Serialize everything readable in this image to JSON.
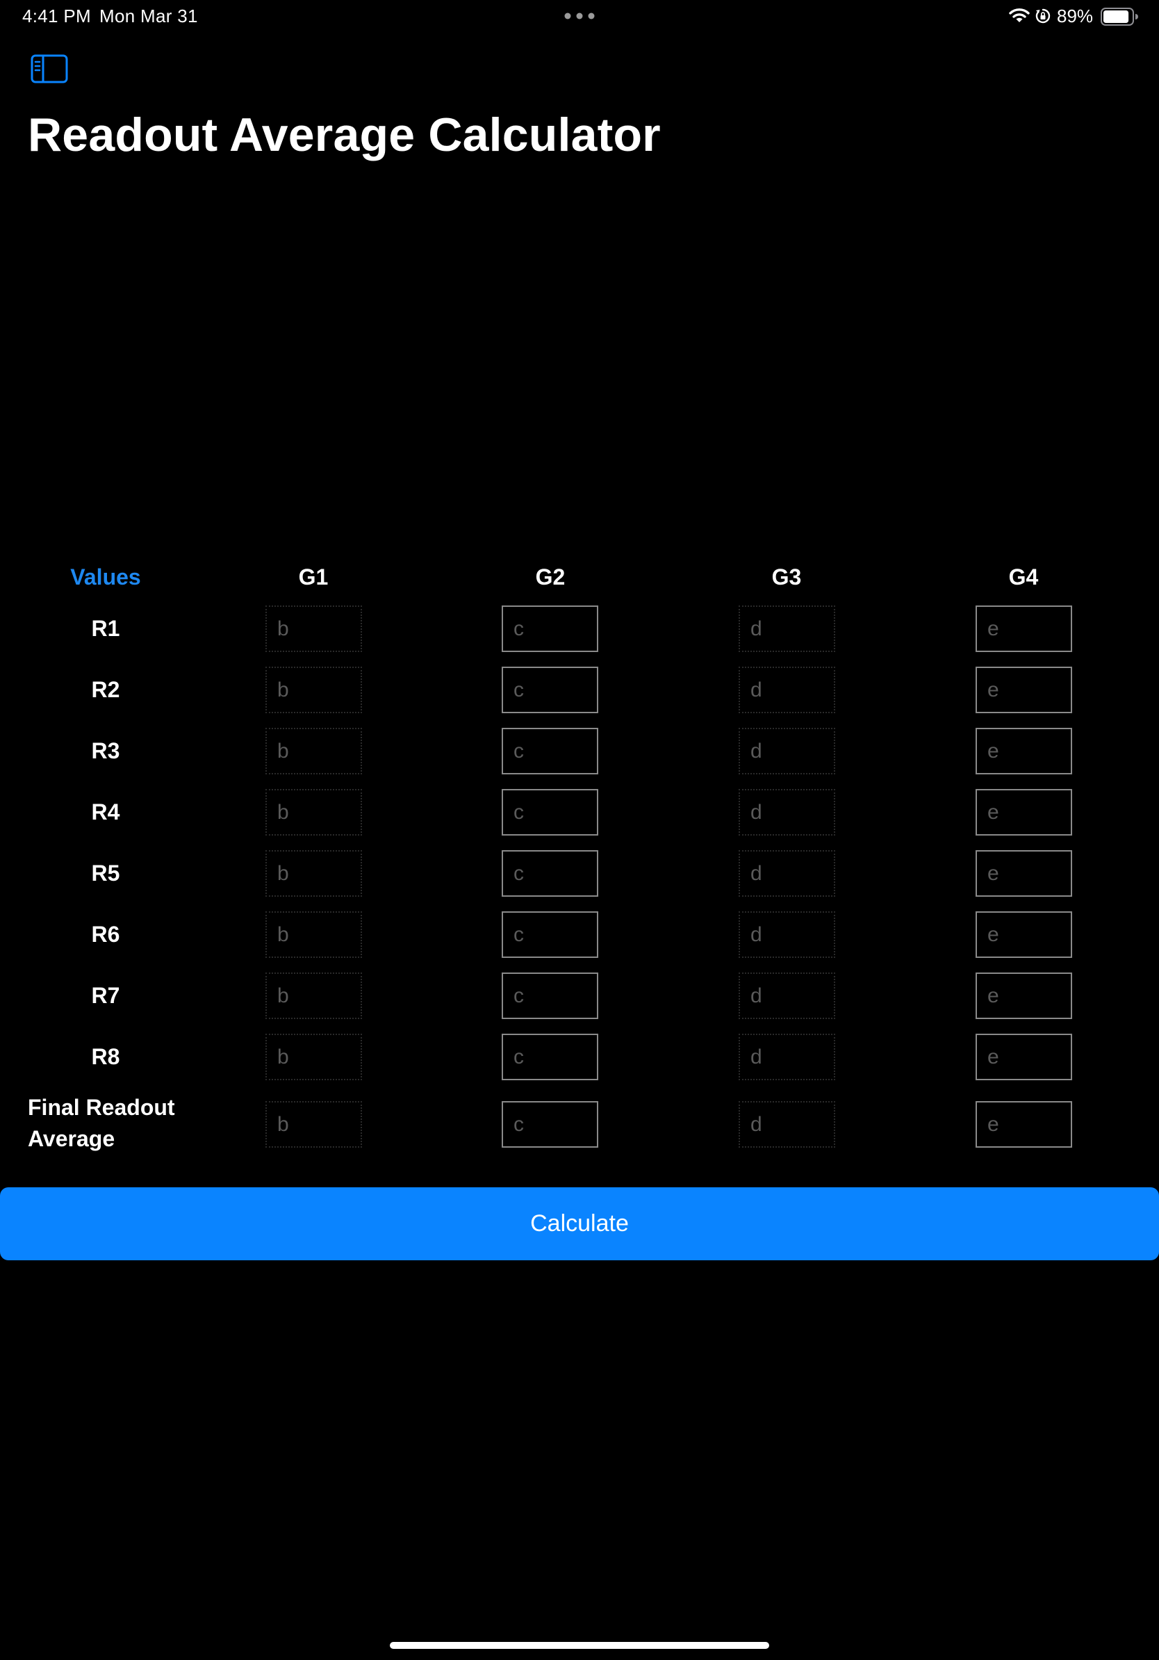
{
  "status_bar": {
    "time": "4:41 PM",
    "date": "Mon Mar 31",
    "battery_percent": "89%",
    "battery_level": 0.89,
    "icons": [
      "wifi-icon",
      "orientation-lock-icon",
      "battery-icon"
    ]
  },
  "header": {
    "sidebar_icon": "sidebar-toggle-icon",
    "title": "Readout Average Calculator"
  },
  "grid": {
    "corner_label": "Values",
    "columns": [
      "G1",
      "G2",
      "G3",
      "G4"
    ],
    "rows": [
      "R1",
      "R2",
      "R3",
      "R4",
      "R5",
      "R6",
      "R7",
      "R8"
    ],
    "final_row": {
      "line1": "Final Readout",
      "line2": "Average"
    },
    "placeholders": [
      "b",
      "c",
      "d",
      "e"
    ],
    "values": {
      "R1": [
        "",
        "",
        "",
        ""
      ],
      "R2": [
        "",
        "",
        "",
        ""
      ],
      "R3": [
        "",
        "",
        "",
        ""
      ],
      "R4": [
        "",
        "",
        "",
        ""
      ],
      "R5": [
        "",
        "",
        "",
        ""
      ],
      "R6": [
        "",
        "",
        "",
        ""
      ],
      "R7": [
        "",
        "",
        "",
        ""
      ],
      "R8": [
        "",
        "",
        "",
        ""
      ],
      "final": [
        "",
        "",
        "",
        ""
      ]
    }
  },
  "actions": {
    "calculate_label": "Calculate"
  },
  "colors": {
    "background": "#000000",
    "accent": "#0a84ff",
    "header_link": "#1e88f0",
    "field_border": "#8a8a8a",
    "placeholder": "#5a5a5a"
  }
}
